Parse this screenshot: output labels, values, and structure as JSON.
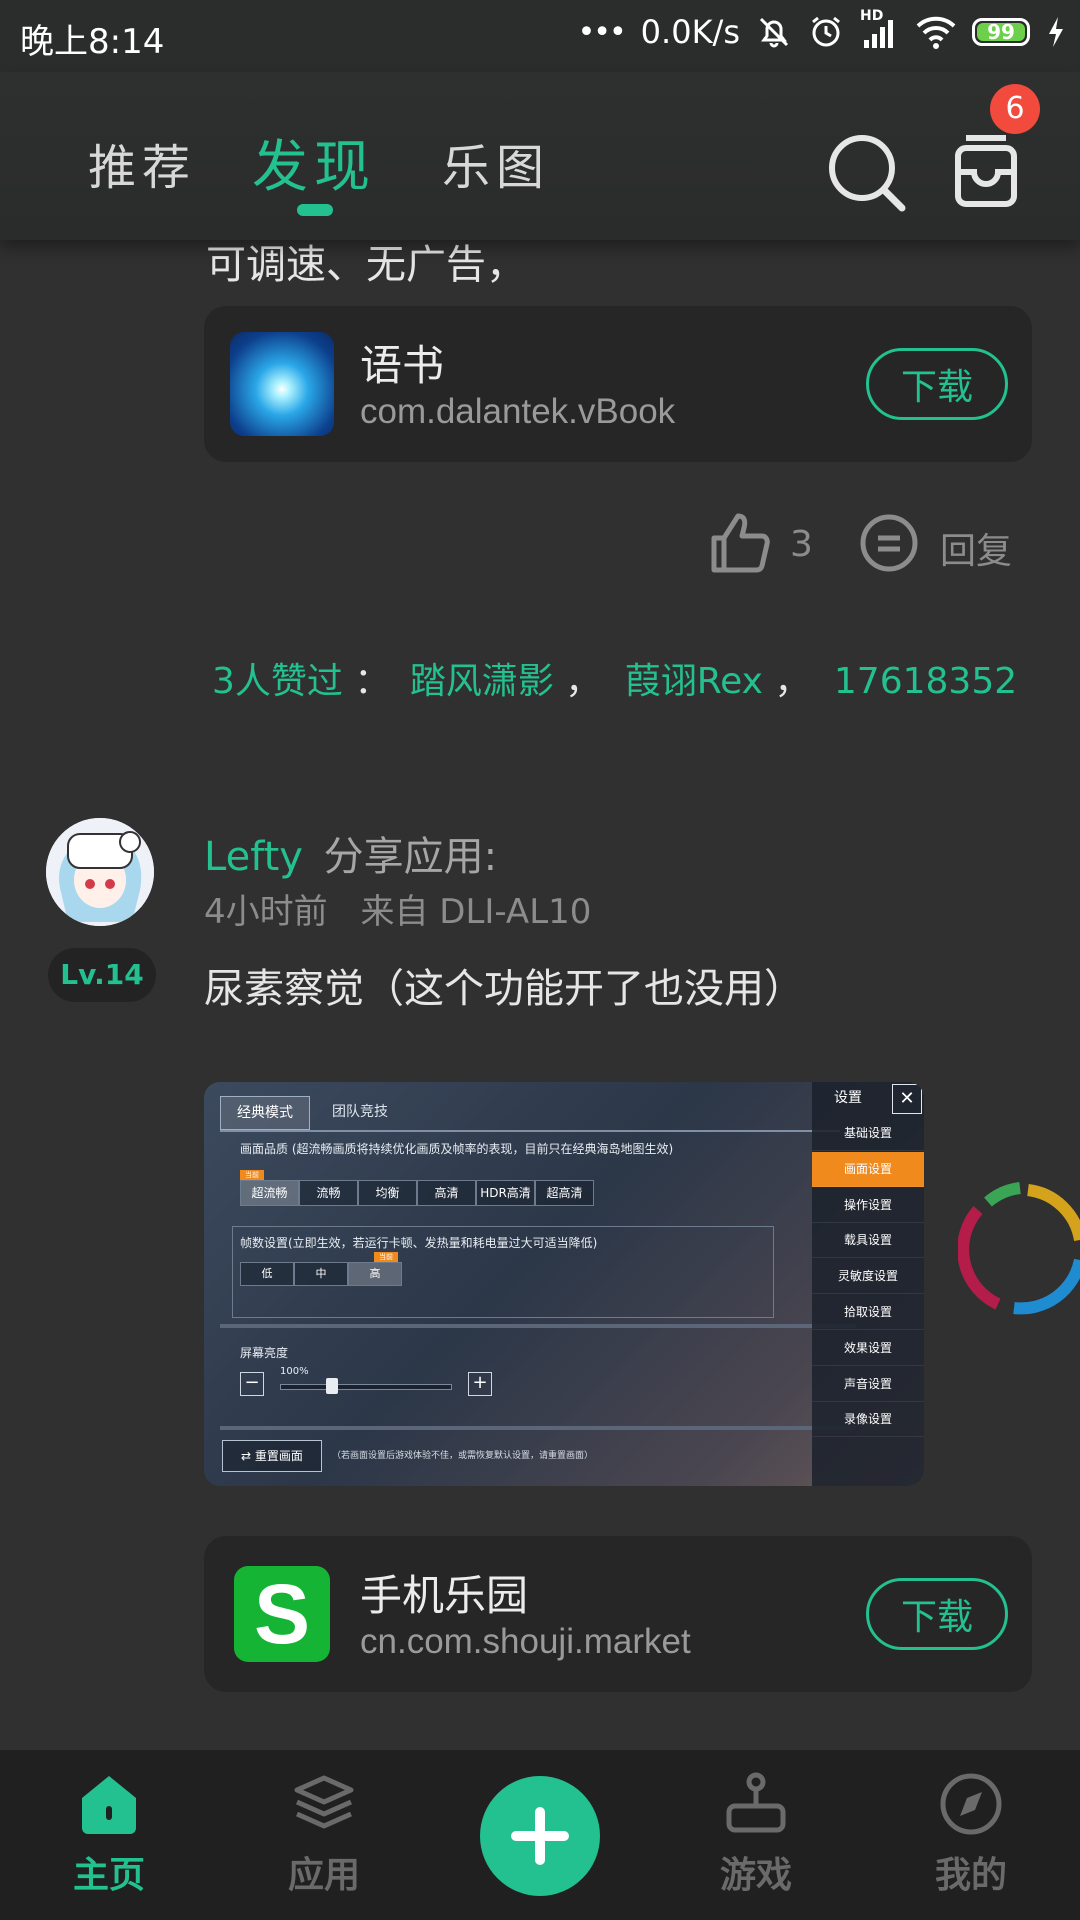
{
  "status_bar": {
    "time": "晚上8:14",
    "speed": "0.0K/s",
    "network": "HD",
    "battery": "99",
    "battery_level": 0.99
  },
  "top_nav": {
    "tabs": [
      {
        "label": "推荐",
        "active": false
      },
      {
        "label": "发现",
        "active": true
      },
      {
        "label": "乐图",
        "active": false
      }
    ],
    "search_icon": "search-icon",
    "inbox_icon": "inbox-icon",
    "inbox_badge": "6"
  },
  "post1": {
    "text_tail": "可调速、无广告，",
    "app": {
      "name": "语书",
      "package": "com.dalantek.vBook",
      "download_label": "下载"
    },
    "like_count": "3",
    "reply_label": "回复",
    "likers": {
      "prefix": "3人赞过",
      "sep": "：",
      "comma": "，",
      "names": [
        "踏风潇影",
        "葭诩Rex",
        "17618352"
      ]
    }
  },
  "post2": {
    "user": "Lefty",
    "action": "分享应用:",
    "time": "4小时前",
    "source": "来自 DLI-AL10",
    "level": "Lv.14",
    "text": "尿素察觉（这个功能开了也没用）",
    "screenshot": {
      "tabs": [
        "经典模式",
        "团队竞技"
      ],
      "quality_title": "画面品质 (超流畅画质将持续优化画质及帧率的表现，目前只在经典海岛地图生效)",
      "quality_tag": "当前",
      "quality_options": [
        "超流畅",
        "流畅",
        "均衡",
        "高清",
        "HDR高清",
        "超高清"
      ],
      "fps_title": "帧数设置(立即生效，若运行卡顿、发热量和耗电量过大可适当降低)",
      "fps_tag": "当前",
      "fps_options": [
        "低",
        "中",
        "高"
      ],
      "brightness_title": "屏幕亮度",
      "brightness_value": "100%",
      "brightness_level": 0.3,
      "reset_label": "重置画面",
      "reset_note": "（若画面设置后游戏体验不佳，或需恢复默认设置，请重置画面）",
      "menu_title": "设置",
      "menu_items": [
        "基础设置",
        "画面设置",
        "操作设置",
        "载具设置",
        "灵敏度设置",
        "拾取设置",
        "效果设置",
        "声音设置",
        "录像设置"
      ],
      "menu_active_index": 1
    },
    "app": {
      "name": "手机乐园",
      "package": "cn.com.shouji.market",
      "download_label": "下载"
    }
  },
  "bottom_nav": {
    "items": [
      {
        "label": "主页",
        "icon": "home-icon",
        "active": true
      },
      {
        "label": "应用",
        "icon": "layers-icon",
        "active": false
      },
      {
        "label": "游戏",
        "icon": "joystick-icon",
        "active": false
      },
      {
        "label": "我的",
        "icon": "compass-icon",
        "active": false
      }
    ],
    "fab_icon": "plus-icon"
  },
  "colors": {
    "accent": "#23c18f",
    "background": "#303030",
    "card": "#262626",
    "badge": "#f24a3d",
    "menu_active": "#f08a1c"
  }
}
